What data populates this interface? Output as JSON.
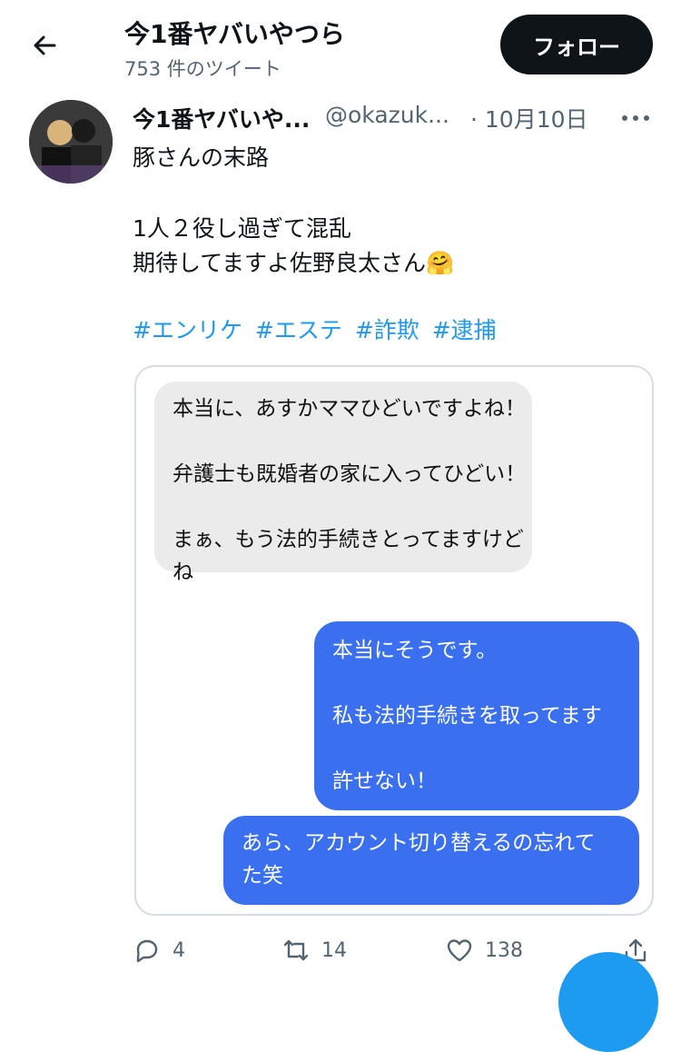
{
  "header": {
    "title": "今1番ヤバいやつら",
    "tweet_count": "753 件のツイート",
    "follow_label": "フォロー"
  },
  "tweet": {
    "display_name": "今1番ヤバいや...",
    "handle": "@okazuk...",
    "date": "· 10月10日",
    "lines": [
      "豚さんの末路",
      "1人２役し過ぎて混乱",
      "期待してますよ佐野良太さん🤗"
    ],
    "hashtags": [
      "#エンリケ",
      "#エステ",
      "#詐欺",
      "#逮捕"
    ]
  },
  "chat": {
    "incoming": "本当に、あすかママひどいですよね！\n\n弁護士も既婚者の家に入ってひどい！\n\nまぁ、もう法的手続きとってますけど\nね",
    "outgoing_1": "本当にそうです。\n\n私も法的手続きを取ってます\n\n許せない！",
    "outgoing_2": "あら、アカウント切り替えるの忘れて\nた笑",
    "incoming_color": "#ebebeb",
    "outgoing_color": "#3a6ff0"
  },
  "actions": {
    "replies": "4",
    "retweets": "14",
    "likes": "138"
  },
  "icons": [
    "back-arrow-icon",
    "more-icon",
    "reply-icon",
    "retweet-icon",
    "like-icon",
    "share-icon"
  ],
  "colors": {
    "accent": "#1d9bf0",
    "follow_bg": "#0f1419",
    "secondary_text": "#536471"
  }
}
